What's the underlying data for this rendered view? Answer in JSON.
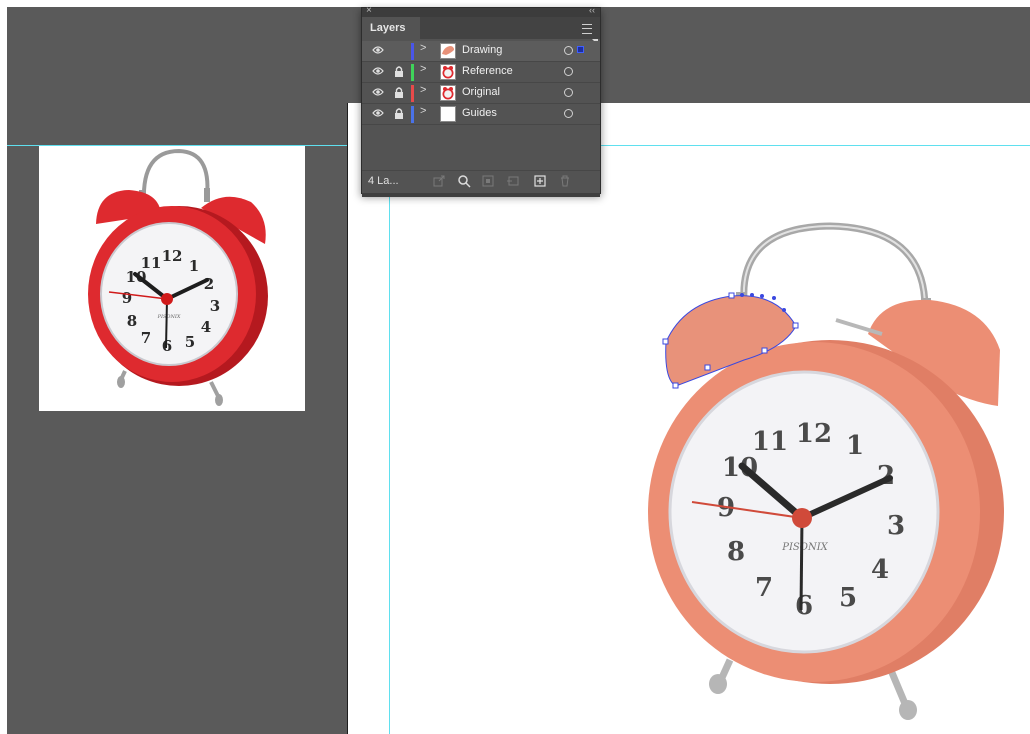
{
  "layers_panel": {
    "tab_label": "Layers",
    "close_glyph": "×",
    "collapse_glyph": "‹‹",
    "layers": [
      {
        "name": "Drawing",
        "color": "#4a56e8",
        "locked": false,
        "visible": true,
        "selected": true,
        "thumb": "drawing-thumbnail"
      },
      {
        "name": "Reference",
        "color": "#3fd35a",
        "locked": true,
        "visible": true,
        "selected": false,
        "thumb": "clock-thumbnail"
      },
      {
        "name": "Original",
        "color": "#e84a4a",
        "locked": true,
        "visible": true,
        "selected": false,
        "thumb": "clock-thumbnail"
      },
      {
        "name": "Guides",
        "color": "#4a72e8",
        "locked": true,
        "visible": true,
        "selected": false,
        "thumb": "blank-thumbnail"
      }
    ],
    "layer_count": "4 La...",
    "footer_icons": [
      "export-icon",
      "search-icon",
      "clip-mask-icon",
      "sublayer-icon",
      "new-layer-icon",
      "delete-icon"
    ]
  },
  "canvas": {
    "small_clock": {
      "dial_numbers": [
        "12",
        "1",
        "2",
        "3",
        "4",
        "5",
        "6",
        "7",
        "8",
        "9",
        "10",
        "11"
      ],
      "brand": "PISONIX",
      "body_color": "#de2a2f"
    },
    "large_clock": {
      "dial_numbers": [
        "12",
        "1",
        "2",
        "3",
        "4",
        "5",
        "6",
        "7",
        "8",
        "9",
        "10",
        "11"
      ],
      "brand": "PISONIX",
      "body_color": "#ec8e74"
    },
    "drawn_shape_color": "#e8927a",
    "path_anchor_color": "#3a48e0",
    "guide_color": "#5fe0ef"
  }
}
